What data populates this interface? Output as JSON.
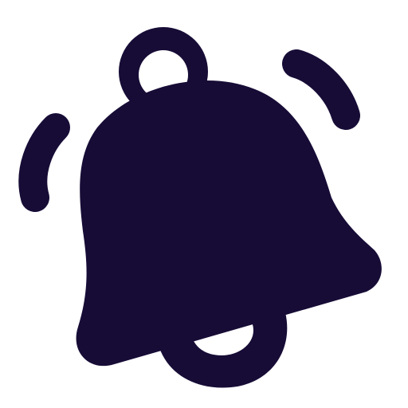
{
  "icon": {
    "name": "ringing-bell-icon",
    "color": "#170c36",
    "background": "#ffffff"
  }
}
